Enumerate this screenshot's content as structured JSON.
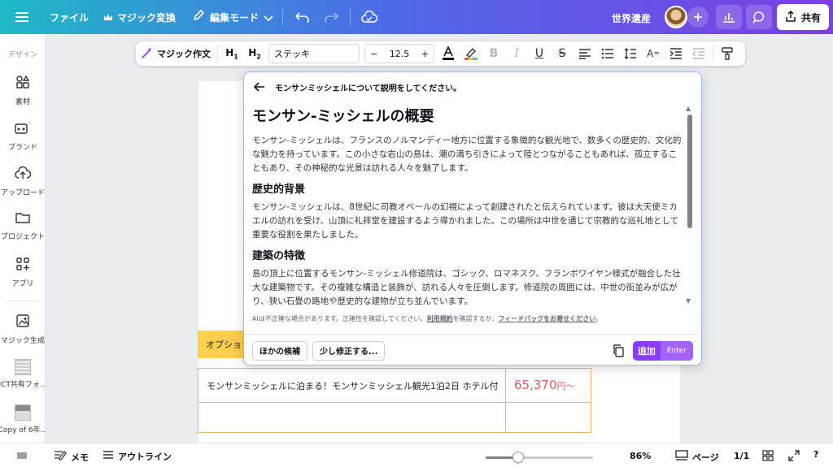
{
  "topbar": {
    "file_label": "ファイル",
    "magic_label": "マジック変換",
    "edit_mode_label": "編集モード",
    "project_title": "世界遺産",
    "share_label": "共有"
  },
  "sidebar": {
    "design_label": "デザイン",
    "items": [
      {
        "label": "素材",
        "icon": "elements-icon"
      },
      {
        "label": "ブランド",
        "icon": "brand-icon"
      },
      {
        "label": "アップロード",
        "icon": "upload-icon"
      },
      {
        "label": "プロジェクト",
        "icon": "folder-icon"
      },
      {
        "label": "アプリ",
        "icon": "apps-icon"
      },
      {
        "label": "マジック生成",
        "icon": "magic-media-icon"
      },
      {
        "label": "ICT共有フォ...",
        "icon": "folder-thumb"
      },
      {
        "label": "Copy of 6年...",
        "icon": "design-thumb"
      }
    ]
  },
  "toolbar": {
    "magic_write_label": "マジック作文",
    "h1_label": "H",
    "h1_sub": "1",
    "h2_label": "H",
    "h2_sub": "2",
    "font_name": "ステッキ",
    "font_size": "12.5",
    "minus": "−",
    "plus": "+"
  },
  "ai_panel": {
    "prompt": "モンサンミッシェルについて説明をしてください。",
    "title": "モンサン-ミッシェルの概要",
    "intro": "モンサン-ミッシェルは、フランスのノルマンディー地方に位置する象徴的な観光地で、数多くの歴史的、文化的な魅力を持っています。この小さな岩山の島は、潮の満ち引きによって陸とつながることもあれば、孤立することもあり、その神秘的な光景は訪れる人々を魅了します。",
    "section1_title": "歴史的背景",
    "section1_text": "モンサン-ミッシェルは、8世紀に司教オベールの幻視によって創建されたと伝えられています。彼は大天使ミカエルの訪れを受け、山頂に礼拝堂を建設するよう導かれました。この場所は中世を通じて宗教的な巡礼地として重要な役割を果たしました。",
    "section2_title": "建築の特徴",
    "section2_text": "島の頂上に位置するモンサン-ミッシェル修道院は、ゴシック、ロマネスク、フランボワイヤン様式が融合した壮大な建築物です。その複雑な構造と装飾が、訪れる人々を圧倒します。修道院の周囲には、中世の街並みが広がり、狭い石畳の路地や歴史的な建物が立ち並んでいます。",
    "disclaimer_pre": "AIは不正確な場合があります。正確性を確認してください。",
    "disclaimer_terms": "利用規約",
    "disclaimer_mid": "を確認するか、",
    "disclaimer_feedback": "フィードバックをお寄せください",
    "disclaimer_end": "。",
    "other_candidates": "ほかの候補",
    "modify_little": "少し修正する...",
    "add_label": "追加",
    "enter_label": "Enter"
  },
  "canvas": {
    "optional_tour": "オプショナルツアー",
    "hotel_text": "モンサンミッシェルに泊まる！モンサンミッシェル観光1泊2日 ホテル付",
    "price": "65,370",
    "price_unit": "円〜"
  },
  "bottombar": {
    "memo_label": "メモ",
    "outline_label": "アウトライン",
    "zoom": "86%",
    "zoom_level": 0.3,
    "page_label": "ページ",
    "page_count": "1/1"
  },
  "colors": {
    "accent": "#8b3dff",
    "gradient_start": "#1fb9c6",
    "gradient_end": "#7b3fe4",
    "price": "#e05a63"
  }
}
